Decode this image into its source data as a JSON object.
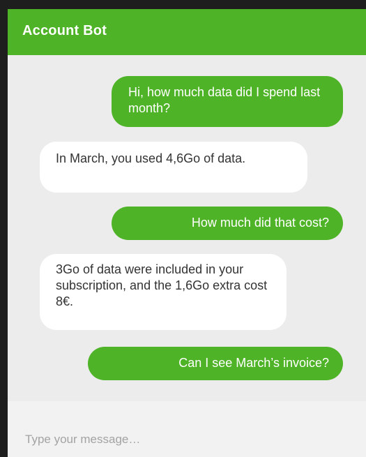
{
  "header": {
    "title": "Account Bot"
  },
  "messages": [
    {
      "sender": "user",
      "text": "Hi, how much data did I spend last month?"
    },
    {
      "sender": "bot",
      "text": "In March, you used 4,6Go of data."
    },
    {
      "sender": "user",
      "text": "How much did that cost?"
    },
    {
      "sender": "bot",
      "text": "3Go of data were included in your subscription, and the 1,6Go extra cost 8€."
    },
    {
      "sender": "user",
      "text": "Can I see March’s invoice?"
    }
  ],
  "composer": {
    "placeholder": "Type your message…"
  },
  "colors": {
    "accent": "#4fb327",
    "background": "#ececec",
    "bot_bubble": "#ffffff"
  }
}
